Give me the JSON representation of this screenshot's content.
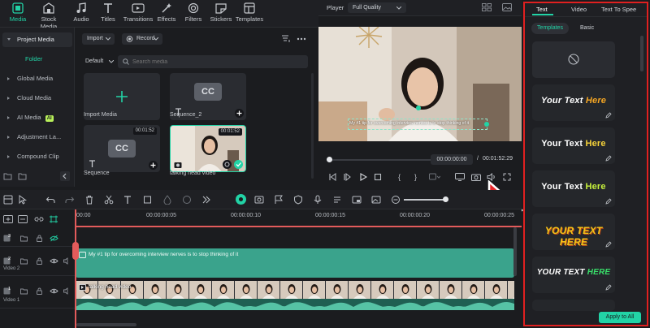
{
  "toolbar": {
    "items": [
      {
        "label": "Media",
        "icon": "media-icon",
        "active": true
      },
      {
        "label": "Stock Media",
        "icon": "stock-media-icon"
      },
      {
        "label": "Audio",
        "icon": "music-note-icon"
      },
      {
        "label": "Titles",
        "icon": "titles-icon"
      },
      {
        "label": "Transitions",
        "icon": "transitions-icon"
      },
      {
        "label": "Effects",
        "icon": "effects-icon"
      },
      {
        "label": "Filters",
        "icon": "filters-icon"
      },
      {
        "label": "Stickers",
        "icon": "stickers-icon"
      },
      {
        "label": "Templates",
        "icon": "templates-icon"
      }
    ]
  },
  "sidebar": {
    "items": [
      {
        "label": "Project Media",
        "selected": true
      },
      {
        "label": "Folder"
      },
      {
        "label": "Global Media"
      },
      {
        "label": "Cloud Media"
      },
      {
        "label": "AI Media",
        "badge": "AI"
      },
      {
        "label": "Adjustment La..."
      },
      {
        "label": "Compound Clip"
      }
    ]
  },
  "media": {
    "import_label": "Import",
    "record_label": "Record",
    "sort_label": "Default",
    "search_placeholder": "Search media",
    "items": [
      {
        "label": "Import Media"
      },
      {
        "label": "Sequence_2"
      },
      {
        "label": "Sequence",
        "duration": "00:01:52"
      },
      {
        "label": "talking head video",
        "duration": "00:01:52"
      }
    ]
  },
  "player": {
    "label": "Player",
    "quality": "Full Quality",
    "current_time": "00:00:00:00",
    "separator": "/",
    "total_time": "00:01:52:29",
    "caption": "My #1 tip for overcoming interview nerves is to stop thinking of it"
  },
  "right_panel": {
    "tabs": [
      "Text",
      "Video",
      "Text To Spee"
    ],
    "subtabs": [
      "Templates",
      "Basic"
    ],
    "templates": [
      {
        "part1": "Your Text",
        "part2": "Here",
        "c1": "#ffffff",
        "c2": "#f5a623"
      },
      {
        "part1": "Your Text",
        "part2": "Here",
        "c1": "#ffffff",
        "c2": "#f5d23a"
      },
      {
        "part1": "Your Text",
        "part2": "Here",
        "c1": "#ffffff",
        "c2": "#c6f03c"
      },
      {
        "part1": "YOUR TEXT",
        "part2": "HERE",
        "c1": "#f5c518",
        "c2": "#f5c518"
      },
      {
        "part1": "YOUR TEXT",
        "part2": "HERE",
        "c1": "#ffffff",
        "c2": "#39e06a"
      }
    ],
    "apply_label": "Apply to All"
  },
  "timeline": {
    "ruler": [
      "00:00",
      "00:00:00:05",
      "00:00:00:10",
      "00:00:00:15",
      "00:00:00:20",
      "00:00:00:25"
    ],
    "tracks": [
      {
        "number": "3",
        "name": ""
      },
      {
        "number": "2",
        "name": "Video 2"
      },
      {
        "number": "1",
        "name": "Video 1"
      }
    ],
    "subtitle_clip": "My #1 tip for overcoming interview nerves is to stop thinking of it",
    "video_clip": "talking head video"
  },
  "colors": {
    "accent": "#22d3a6",
    "highlight_border": "#e02020",
    "arrow": "#e8262a",
    "subtitle_clip_bg": "#3aa38c"
  }
}
